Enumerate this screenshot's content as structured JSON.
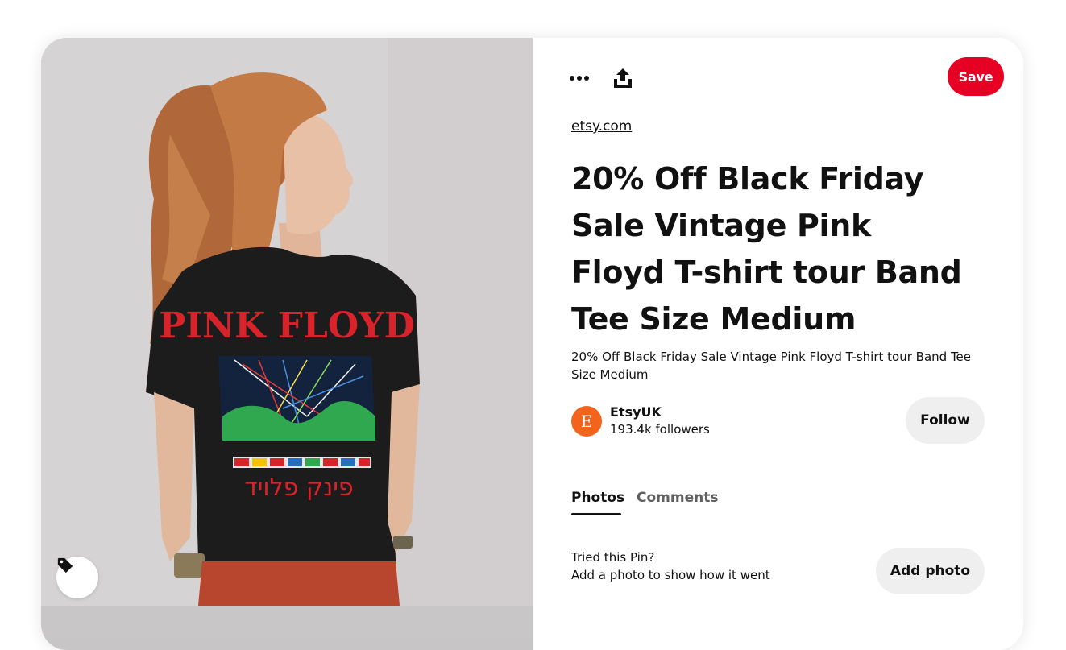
{
  "toolbar": {
    "more_icon": "more-horizontal-icon",
    "share_icon": "share-upload-icon",
    "save_label": "Save"
  },
  "pin": {
    "source": "etsy.com",
    "title": "20% Off Black Friday Sale Vintage Pink Floyd T-shirt tour Band Tee Size Medium",
    "description": "20% Off Black Friday Sale Vintage Pink Floyd T-shirt tour Band Tee Size Medium"
  },
  "image": {
    "shirt_text": "PINK FLOYD",
    "shirt_hebrew": "פינק פלויד",
    "tag_icon": "tag-icon"
  },
  "creator": {
    "avatar_letter": "E",
    "name": "EtsyUK",
    "followers": "193.4k followers",
    "follow_label": "Follow"
  },
  "tabs": [
    {
      "label": "Photos",
      "active": true
    },
    {
      "label": "Comments",
      "active": false
    }
  ],
  "tried": {
    "title": "Tried this Pin?",
    "subtitle": "Add a photo to show how it went",
    "button_label": "Add photo"
  },
  "colors": {
    "save": "#e60023",
    "avatar": "#f1641e",
    "button_gray": "#efefef"
  }
}
